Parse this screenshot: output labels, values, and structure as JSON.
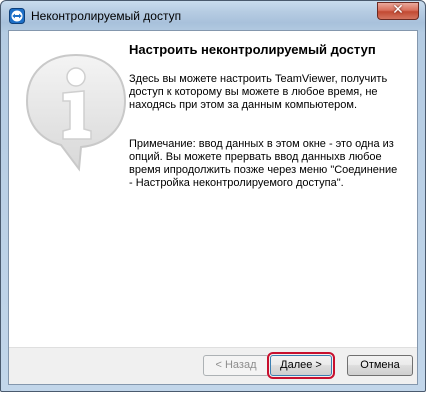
{
  "window": {
    "title": "Неконтролируемый доступ",
    "close_label": "✕"
  },
  "wizard": {
    "heading": "Настроить неконтролируемый доступ",
    "intro": "Здесь вы можете настроить TeamViewer, получить доступ к которому вы можете в любое время, не находясь при этом за данным компьютером.",
    "note": "Примечание: ввод данных в этом окне  - это одна из опций. Вы можете прервать ввод данныхв любое время ипродолжить позже через меню \"Соединение - Настройка неконтролируемого доступа\"."
  },
  "buttons": {
    "back": "< Назад",
    "next": "Далее >",
    "cancel": "Отмена"
  },
  "icons": {
    "app": "teamviewer-icon",
    "info": "info-speech-bubble-icon"
  },
  "colors": {
    "highlight_outline": "#c8102e",
    "close_button": "#c24a33"
  }
}
